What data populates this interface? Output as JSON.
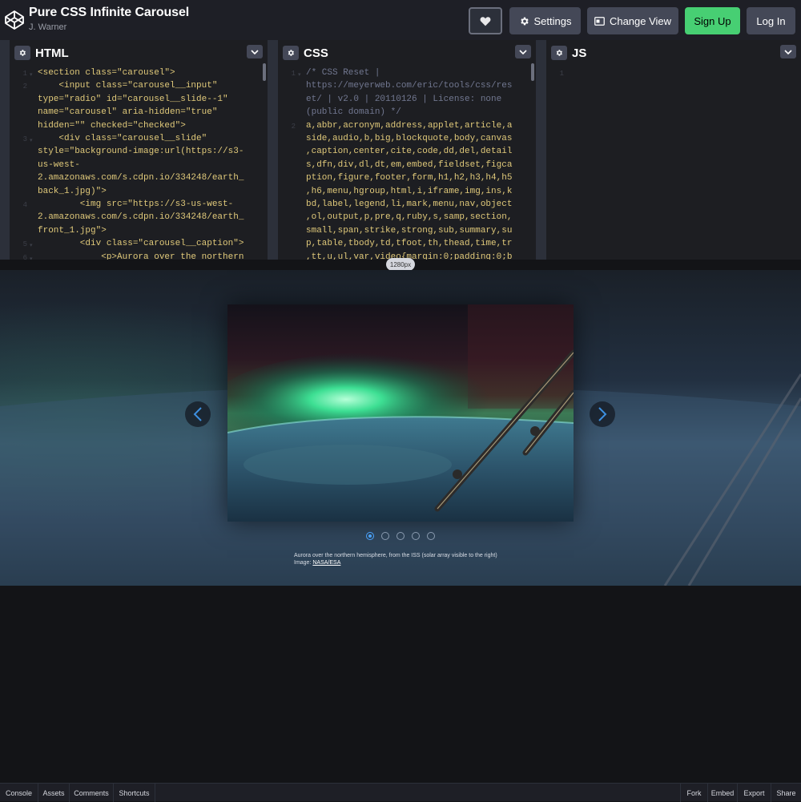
{
  "header": {
    "title": "Pure CSS Infinite Carousel",
    "author": "J. Warner",
    "settings_label": "Settings",
    "change_view_label": "Change View",
    "signup_label": "Sign Up",
    "login_label": "Log In"
  },
  "panels": {
    "html_label": "HTML",
    "css_label": "CSS",
    "js_label": "JS"
  },
  "html_code": [
    {
      "n": "1",
      "fold": true,
      "text": "<section class=\"carousel\">"
    },
    {
      "n": "2",
      "fold": false,
      "text": "    <input class=\"carousel__input\""
    },
    {
      "n": "",
      "fold": false,
      "text": "type=\"radio\" id=\"carousel__slide--1\""
    },
    {
      "n": "",
      "fold": false,
      "text": "name=\"carousel\" aria-hidden=\"true\""
    },
    {
      "n": "",
      "fold": false,
      "text": "hidden=\"\" checked=\"checked\">"
    },
    {
      "n": "3",
      "fold": true,
      "text": "    <div class=\"carousel__slide\""
    },
    {
      "n": "",
      "fold": false,
      "text": "style=\"background-image:url(https://s3-"
    },
    {
      "n": "",
      "fold": false,
      "text": "us-west-"
    },
    {
      "n": "",
      "fold": false,
      "text": "2.amazonaws.com/s.cdpn.io/334248/earth_"
    },
    {
      "n": "",
      "fold": false,
      "text": "back_1.jpg)\">"
    },
    {
      "n": "4",
      "fold": false,
      "text": "        <img src=\"https://s3-us-west-"
    },
    {
      "n": "",
      "fold": false,
      "text": "2.amazonaws.com/s.cdpn.io/334248/earth_"
    },
    {
      "n": "",
      "fold": false,
      "text": "front_1.jpg\">"
    },
    {
      "n": "5",
      "fold": true,
      "text": "        <div class=\"carousel__caption\">"
    },
    {
      "n": "6",
      "fold": true,
      "text": "            <p>Aurora over the northern"
    }
  ],
  "css_code": [
    {
      "n": "1",
      "fold": true,
      "text": "/* CSS Reset |"
    },
    {
      "n": "",
      "fold": false,
      "text": "https://meyerweb.com/eric/tools/css/res"
    },
    {
      "n": "",
      "fold": false,
      "text": "et/ | v2.0 | 20110126 | License: none"
    },
    {
      "n": "",
      "fold": false,
      "text": "(public domain) */"
    },
    {
      "n": "2",
      "fold": false,
      "text": "a,abbr,acronym,address,applet,article,a"
    },
    {
      "n": "",
      "fold": false,
      "text": "side,audio,b,big,blockquote,body,canvas"
    },
    {
      "n": "",
      "fold": false,
      "text": ",caption,center,cite,code,dd,del,detail"
    },
    {
      "n": "",
      "fold": false,
      "text": "s,dfn,div,dl,dt,em,embed,fieldset,figca"
    },
    {
      "n": "",
      "fold": false,
      "text": "ption,figure,footer,form,h1,h2,h3,h4,h5"
    },
    {
      "n": "",
      "fold": false,
      "text": ",h6,menu,hgroup,html,i,iframe,img,ins,k"
    },
    {
      "n": "",
      "fold": false,
      "text": "bd,label,legend,li,mark,menu,nav,object"
    },
    {
      "n": "",
      "fold": false,
      "text": ",ol,output,p,pre,q,ruby,s,samp,section,"
    },
    {
      "n": "",
      "fold": false,
      "text": "small,span,strike,strong,sub,summary,su"
    },
    {
      "n": "",
      "fold": false,
      "text": "p,table,tbody,td,tfoot,th,thead,time,tr"
    },
    {
      "n": "",
      "fold": false,
      "text": ",tt,u,ul,var,video{margin:0;padding:0;b"
    }
  ],
  "js_code": [
    {
      "n": "1",
      "fold": false,
      "text": ""
    }
  ],
  "preview": {
    "size_badge": "1280px",
    "caption_line1": "Aurora over the northern hemisphere, from the ISS (solar array visible to the right)",
    "caption_prefix": "Image: ",
    "caption_link": "NASA/ESA",
    "slide_count": 5,
    "active_slide": 1
  },
  "footer": {
    "console": "Console",
    "assets": "Assets",
    "comments": "Comments",
    "shortcuts": "Shortcuts",
    "fork": "Fork",
    "embed": "Embed",
    "export": "Export",
    "share": "Share"
  },
  "colors": {
    "signup": "#47cf73",
    "header_bg": "#1e1f26",
    "editor_bg": "#1d1e22",
    "active_dot": "#4aa3ff"
  }
}
